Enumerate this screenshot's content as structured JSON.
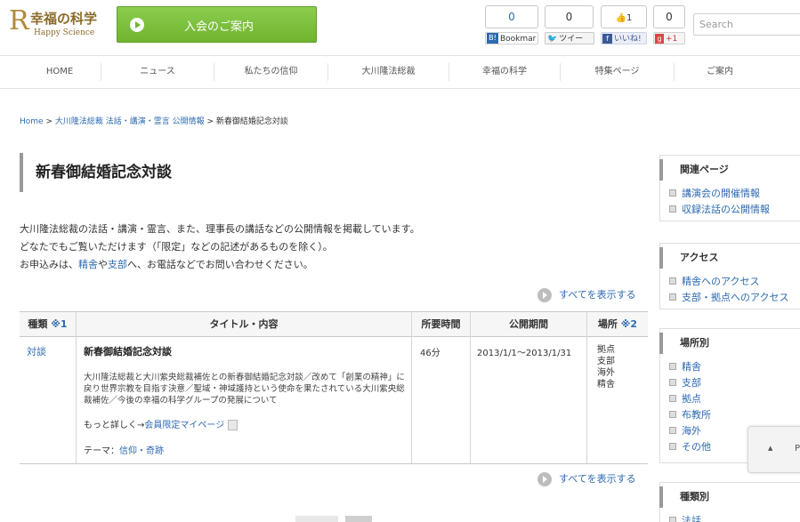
{
  "header": {
    "logo_mark": "R",
    "logo_ja": "幸福の科学",
    "logo_en": "Happy Science",
    "join_label": "入会のご案内",
    "search_placeholder": "Search",
    "social": {
      "hatena_count": "0",
      "hatena_label": "Bookmar",
      "tweet_count": "0",
      "tweet_label": "ツイー",
      "like_count": "1",
      "like_label": "いいね!",
      "plusone_count": "0",
      "plusone_label": "+1"
    }
  },
  "nav": [
    "HOME",
    "ニュース",
    "私たちの信仰",
    "大川隆法総裁",
    "幸福の科学",
    "特集ページ",
    "ご案内"
  ],
  "breadcrumb": {
    "home": "Home",
    "sep1": " > ",
    "section": "大川隆法総裁 法話・講演・霊言 公開情報",
    "sep2": " > ",
    "current": "新春御結婚記念対談"
  },
  "page_title": "新春御結婚記念対談",
  "intro": {
    "line1": "大川隆法総裁の法話・講演・霊言、また、理事長の講話などの公開情報を掲載しています。",
    "line2": "どなたでもご覧いただけます（「限定」などの記述があるものを除く）。",
    "line3_a": "お申込みは、",
    "line3_link1": "精舎",
    "line3_b": "や",
    "line3_link2": "支部",
    "line3_c": "へ、お電話などでお問い合わせください。"
  },
  "show_all": "すべてを表示する",
  "table": {
    "headers": {
      "type": "種類",
      "type_mark": "※1",
      "title": "タイトル・内容",
      "duration": "所要時間",
      "period": "公開期間",
      "place": "場所",
      "place_mark": "※2"
    },
    "row": {
      "type": "対談",
      "title": "新春御結婚記念対談",
      "desc": "大川隆法総裁と大川紫央総裁補佐との新春御結婚記念対談／改めて「創業の精神」に戻り世界宗教を目指す決意／聖域・神域護持という使命を果たされている大川紫央総裁補佐／今後の幸福の科学グループの発展について",
      "more_prefix": "もっと詳しく→",
      "more_link": "会員限定マイページ",
      "theme_prefix": "テーマ：",
      "theme_link": "信仰・奇跡",
      "duration": "46分",
      "period": "2013/1/1～2013/1/31",
      "places": [
        "拠点",
        "支部",
        "海外",
        "精舎"
      ]
    }
  },
  "sidebar": {
    "related": {
      "title": "関連ページ",
      "items": [
        "講演会の開催情報",
        "収録法話の公開情報"
      ]
    },
    "access": {
      "title": "アクセス",
      "items": [
        "精舎へのアクセス",
        "支部・拠点へのアクセス"
      ]
    },
    "by_place": {
      "title": "場所別",
      "items": [
        "精舎",
        "支部",
        "拠点",
        "布教所",
        "海外",
        "その他"
      ]
    },
    "by_type": {
      "title": "種類別",
      "items": [
        "法話"
      ]
    }
  },
  "float": {
    "up": "▲",
    "p": "P"
  },
  "colors": {
    "link": "#2e6ab1",
    "join_button": "#7cbf3b",
    "logo": "#8b6b2a"
  }
}
